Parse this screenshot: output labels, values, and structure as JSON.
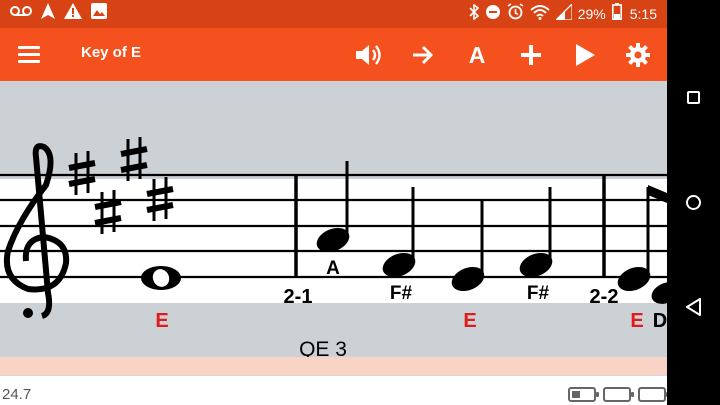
{
  "status_bar": {
    "left_icons": [
      "voicemail-icon",
      "navigation-icon",
      "warning-icon",
      "image-icon"
    ],
    "right_icons": [
      "bluetooth-icon",
      "do-not-disturb-icon",
      "alarm-icon",
      "wifi-icon",
      "signal-icon"
    ],
    "battery": "29%",
    "time": "5:15"
  },
  "toolbar": {
    "title": "Key of E",
    "menu_icon": "hamburger-menu-icon",
    "actions": [
      {
        "icon": "volume-icon"
      },
      {
        "icon": "arrow-right-icon"
      },
      {
        "label": "A"
      },
      {
        "icon": "plus-icon"
      },
      {
        "icon": "play-icon"
      },
      {
        "icon": "settings-gear-icon"
      }
    ],
    "accent_color": "#f4511e",
    "status_color": "#d84315"
  },
  "score": {
    "clef": "treble-clef",
    "key_signature": "E major (4 sharps)",
    "notes": [
      {
        "letter": "E",
        "above_label": "",
        "below_label": "E",
        "duration": "whole"
      },
      {
        "letter": "A",
        "above_label": "A",
        "below_label": "",
        "duration": "quarter"
      },
      {
        "letter": "F#",
        "above_label": "F#",
        "below_label": "",
        "duration": "quarter"
      },
      {
        "letter": "E",
        "above_label": "",
        "below_label": "E",
        "duration": "quarter"
      },
      {
        "letter": "F#",
        "above_label": "F#",
        "below_label": "",
        "duration": "quarter"
      },
      {
        "letter": "E",
        "above_label": "",
        "below_label": "E",
        "duration": "eighth"
      },
      {
        "letter": "D",
        "above_label": "",
        "below_label": "D",
        "duration": "eighth"
      }
    ],
    "measure_labels": [
      "2-1",
      "2-2"
    ],
    "section_label": "QE 3",
    "red_label_color": "#e01b1b"
  },
  "footer": {
    "zoom": "24.7"
  },
  "nav_bar": {
    "recent_icon": "recent-apps-icon",
    "home_icon": "home-icon",
    "back_icon": "back-icon"
  }
}
